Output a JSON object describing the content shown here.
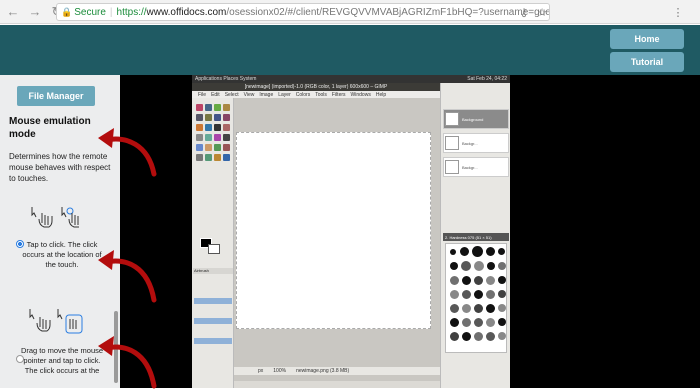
{
  "browser": {
    "secure_label": "Secure",
    "url_scheme": "https://",
    "url_host": "www.offidocs.com",
    "url_path": "/osessionx02/#/client/REVGQVVMVABjAGRIZmF1bHQ=?username=guest04&passwo..."
  },
  "header": {
    "home_label": "Home",
    "tutorial_label": "Tutorial"
  },
  "left_panel": {
    "file_manager_label": "File Manager",
    "title": "Mouse emulation mode",
    "description": "Determines how the remote mouse behaves with respect to touches.",
    "option_tap": "Tap to click. The click occurs at the location of the touch.",
    "option_drag": "Drag to move the mouse pointer and tap to click. The click occurs at the",
    "option_tap_selected": true
  },
  "gimp": {
    "topbar": "Applications   Places   System",
    "clock": "Sat Feb 24, 04:22",
    "titlebar": "[newimage] (imported)-1.0 (RGB color, 1 layer) 600x600 – GIMP",
    "menu": [
      "File",
      "Edit",
      "Select",
      "View",
      "Image",
      "Layer",
      "Colors",
      "Tools",
      "Filters",
      "Windows",
      "Help"
    ],
    "zoom": "100%",
    "status": "newimage.png (3.8 MB)",
    "units": "px",
    "brushes_title": "2. Hardness 075 (51 × 51)",
    "layers": [
      "Background",
      "Backgr...",
      "Backgr..."
    ],
    "attributes_label": "Airbrush"
  }
}
